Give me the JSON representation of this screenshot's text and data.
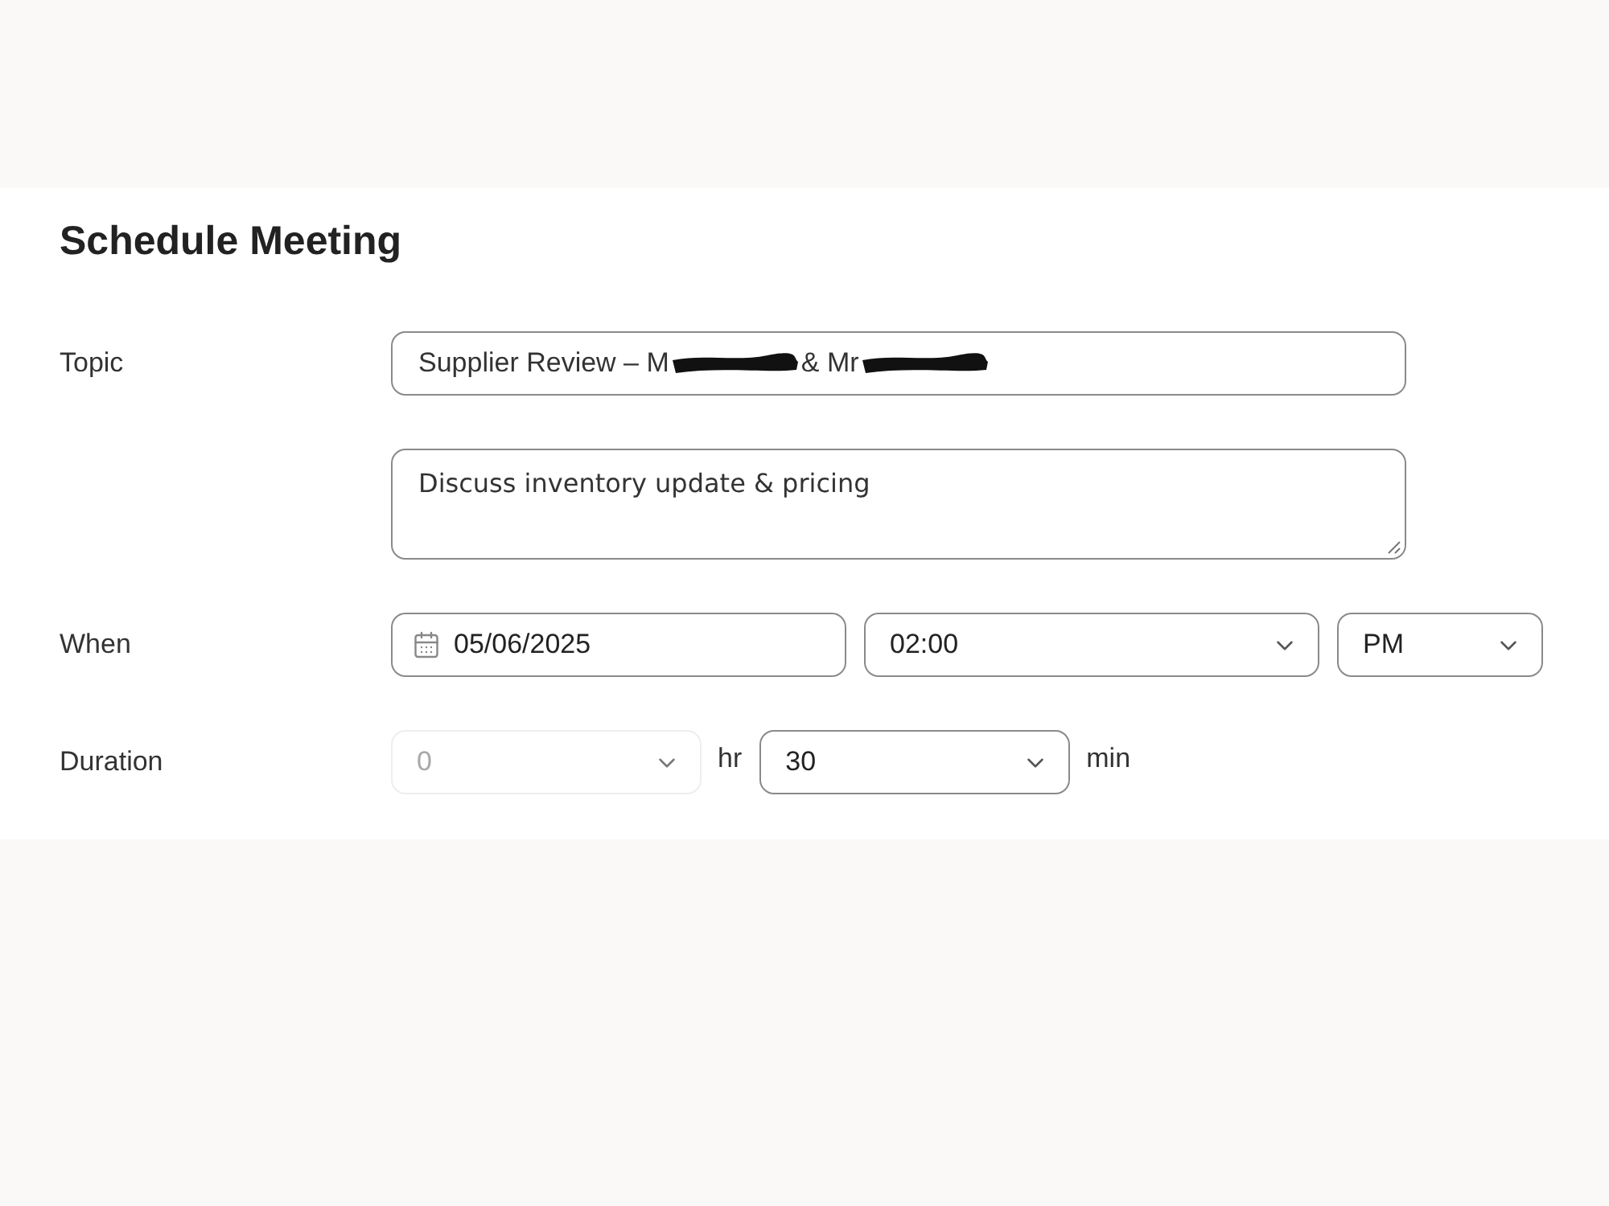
{
  "title": "Schedule Meeting",
  "topic": {
    "label": "Topic",
    "value_parts": [
      {
        "kind": "text",
        "text": "Supplier Review – M"
      },
      {
        "kind": "redaction"
      },
      {
        "kind": "text",
        "text": "& Mr"
      },
      {
        "kind": "redaction"
      }
    ]
  },
  "description": {
    "value": "Discuss inventory update & pricing"
  },
  "when": {
    "label": "When",
    "date": "05/06/2025",
    "time": {
      "value": "02:00",
      "disabled": false
    },
    "period": {
      "value": "PM",
      "disabled": false
    }
  },
  "duration": {
    "label": "Duration",
    "hours": {
      "value": "0",
      "disabled": true
    },
    "hours_unit": "hr",
    "minutes": {
      "value": "30",
      "disabled": false
    },
    "minutes_unit": "min"
  }
}
